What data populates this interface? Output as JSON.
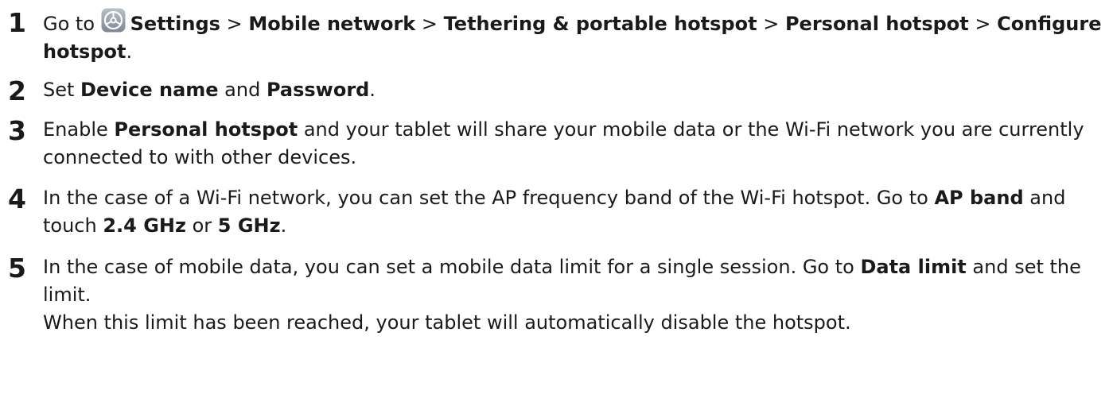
{
  "steps": [
    {
      "number": "1",
      "go_to": "Go to ",
      "settings": "Settings",
      "sep1": " > ",
      "mobile_network": "Mobile network",
      "sep2": " > ",
      "tethering": "Tethering & portable hotspot",
      "sep3": " > ",
      "personal_hotspot": "Personal hotspot",
      "sep4": " > ",
      "configure_hotspot": "Configure hotspot",
      "end": ".",
      "icon": "settings-gear-icon",
      "icon_color": "#8a93a4"
    },
    {
      "number": "2",
      "set": "Set ",
      "device_name": "Device name",
      "and": " and ",
      "password": "Password",
      "end": "."
    },
    {
      "number": "3",
      "enable": "Enable ",
      "personal_hotspot": "Personal hotspot",
      "text": " and your tablet will share your mobile data or the Wi-Fi network you are currently connected to with other devices."
    },
    {
      "number": "4",
      "text1": "In the case of a Wi-Fi network, you can set the AP frequency band of the Wi-Fi hotspot. Go to ",
      "ap_band": "AP band",
      "text2": " and touch ",
      "ghz_24": "2.4 GHz",
      "or": " or ",
      "ghz_5": "5 GHz",
      "end": "."
    },
    {
      "number": "5",
      "text1": "In the case of mobile data, you can set a mobile data limit for a single session. Go to ",
      "data_limit": "Data limit",
      "text2": " and set the limit.",
      "text3": "When this limit has been reached, your tablet will automatically disable the hotspot."
    }
  ]
}
